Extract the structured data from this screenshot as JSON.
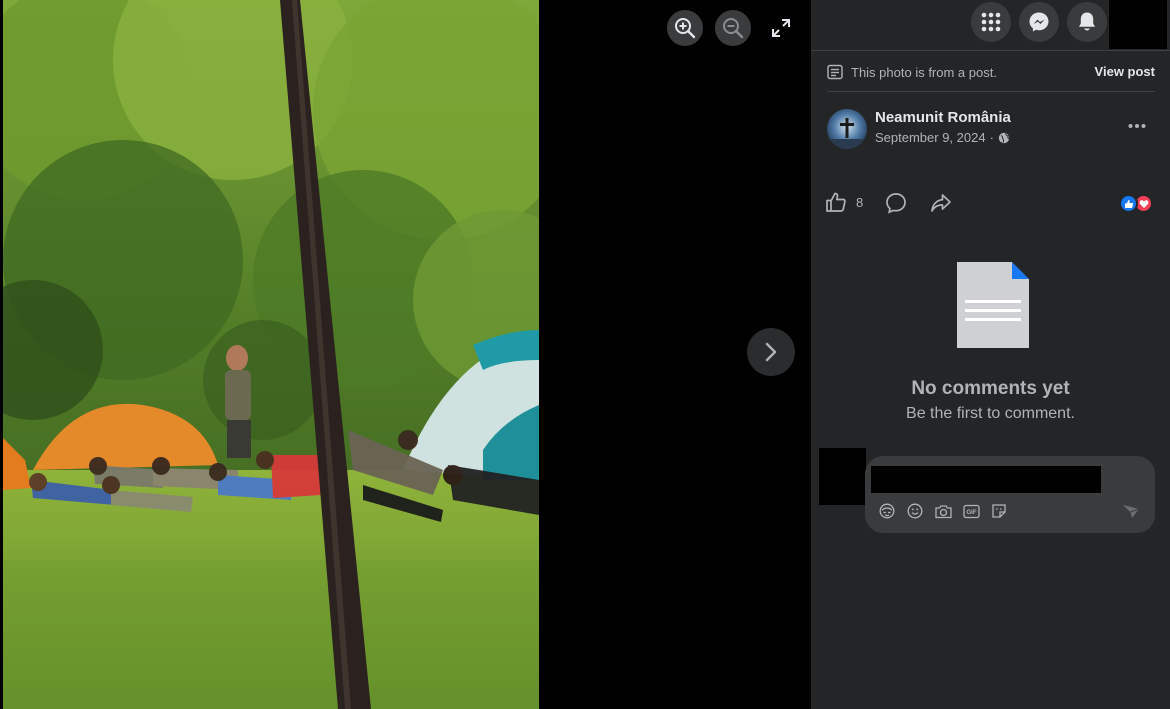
{
  "viewer": {
    "icons": {
      "zoom_in": "zoom-in-icon",
      "zoom_out": "zoom-out-icon",
      "fullscreen": "fullscreen-icon",
      "next": "chevron-right-icon"
    }
  },
  "nav": {
    "icons": [
      "menu-grid-icon",
      "messenger-icon",
      "bell-icon"
    ]
  },
  "notice": {
    "text": "This photo is from a post.",
    "link": "View post"
  },
  "post": {
    "author": "Neamunit România",
    "date": "September 9, 2024",
    "separator": "·",
    "privacy_icon": "globe-icon",
    "like_count": "8",
    "reactions": [
      "like",
      "love"
    ]
  },
  "comments": {
    "title": "No comments yet",
    "subtitle": "Be the first to comment.",
    "icon": "document-icon"
  },
  "composer": {
    "placeholder": "",
    "tools": [
      "avatar-sticker-icon",
      "emoji-icon",
      "camera-icon",
      "gif-icon",
      "sticker-icon",
      "send-icon"
    ]
  },
  "colors": {
    "panel_bg": "#242526",
    "surface": "#3a3b3c",
    "primary_text": "#e4e6eb",
    "secondary_text": "#b0b3b8",
    "like_blue": "#1877f2",
    "love_red": "#f33e58"
  }
}
